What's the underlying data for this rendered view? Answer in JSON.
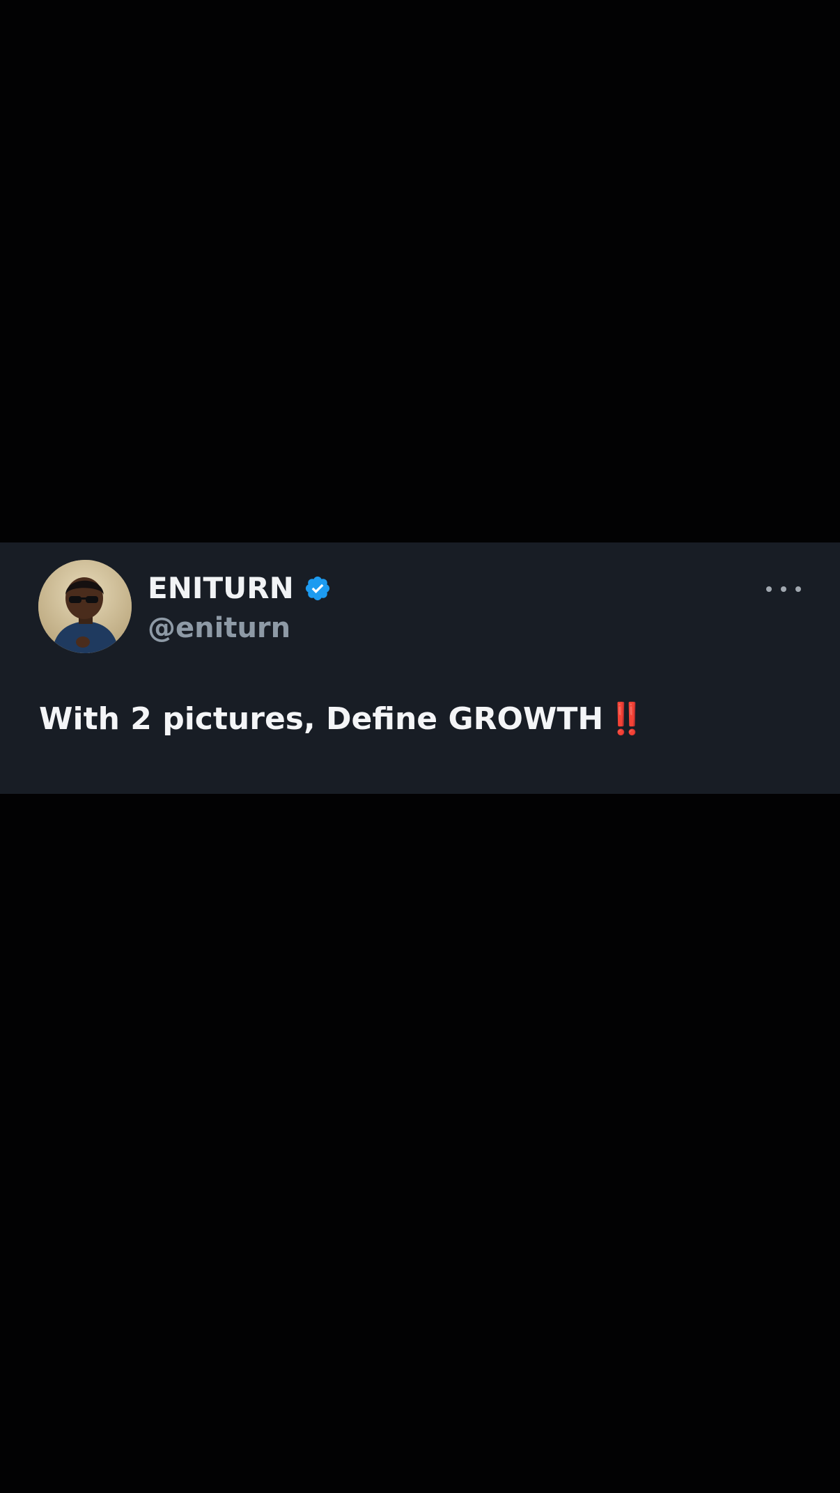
{
  "tweet": {
    "display_name": "ENITURN",
    "handle": "@eniturn",
    "text": "With 2 pictures, Define GROWTH",
    "emphasis": "‼️",
    "verified": true,
    "more_icon": "more-horizontal-icon",
    "badge_icon": "verified-badge-icon"
  },
  "colors": {
    "background": "#020203",
    "card": "#181d25",
    "verified_blue": "#1d9bf0",
    "handle_gray": "#8e9aa6",
    "emphasis_red": "#e0241b"
  }
}
